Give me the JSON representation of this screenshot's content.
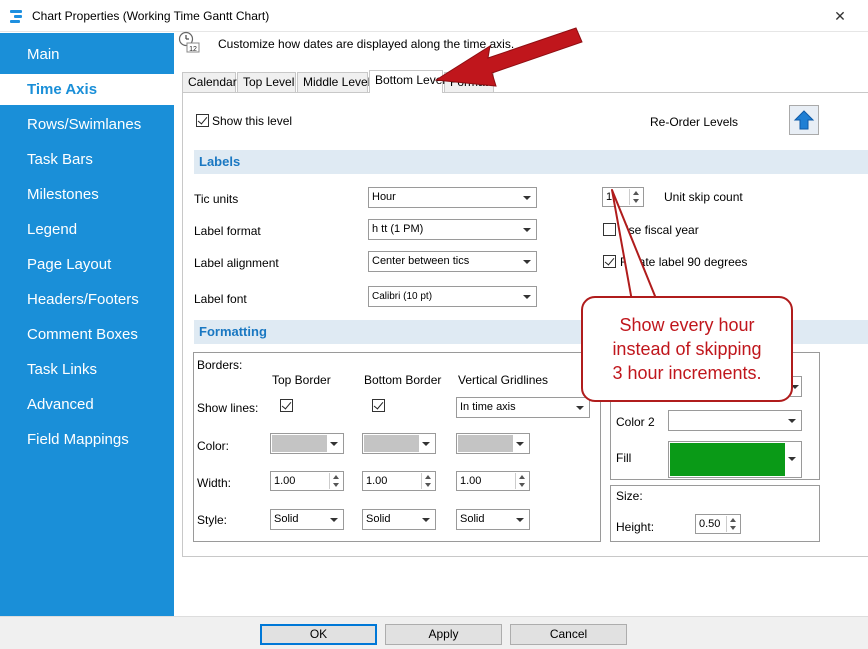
{
  "window": {
    "title": "Chart Properties (Working Time Gantt Chart)",
    "close_glyph": "✕",
    "icon": "app-icon"
  },
  "sidebar": {
    "items": [
      {
        "label": "Main"
      },
      {
        "label": "Time Axis"
      },
      {
        "label": "Rows/Swimlanes"
      },
      {
        "label": "Task Bars"
      },
      {
        "label": "Milestones"
      },
      {
        "label": "Legend"
      },
      {
        "label": "Page Layout"
      },
      {
        "label": "Headers/Footers"
      },
      {
        "label": "Comment Boxes"
      },
      {
        "label": "Task Links"
      },
      {
        "label": "Advanced"
      },
      {
        "label": "Field Mappings"
      }
    ],
    "active": "Time Axis"
  },
  "header": {
    "icon_text": "12",
    "text": "Customize how dates are displayed along the time axis."
  },
  "tabs": [
    {
      "label": "Calendar"
    },
    {
      "label": "Top Level"
    },
    {
      "label": "Middle Level"
    },
    {
      "label": "Bottom Level"
    },
    {
      "label": "Format"
    }
  ],
  "active_tab": "Bottom Level",
  "level": {
    "show_this_level_label": "Show this level",
    "show_this_level_checked": true,
    "reorder_label": "Re-Order Levels"
  },
  "labels_section": {
    "title": "Labels",
    "tic_units_label": "Tic units",
    "tic_units_value": "Hour",
    "label_format_label": "Label format",
    "label_format_value": "h tt (1 PM)",
    "label_alignment_label": "Label alignment",
    "label_alignment_value": "Center between tics",
    "label_font_label": "Label font",
    "label_font_value": "Calibri (10 pt)",
    "unit_skip_value": "1",
    "unit_skip_label": "Unit skip count",
    "fiscal_year_label": "Use fiscal year",
    "fiscal_year_checked": false,
    "rotate_label": "Rotate label 90 degrees",
    "rotate_checked": true
  },
  "formatting_section": {
    "title": "Formatting",
    "borders_label": "Borders:",
    "col_top": "Top Border",
    "col_bottom": "Bottom Border",
    "col_vertical": "Vertical Gridlines",
    "show_lines_label": "Show lines:",
    "top_checked": true,
    "bottom_checked": true,
    "vertical_value": "In time axis",
    "color_label": "Color:",
    "width_label": "Width:",
    "width_top": "1.00",
    "width_bottom": "1.00",
    "width_vertical": "1.00",
    "style_label": "Style:",
    "style_top": "Solid",
    "style_bottom": "Solid",
    "style_vertical": "Solid",
    "color2_label": "Color 2",
    "fill_label": "Fill",
    "fill_color": "#0a9a17",
    "size_label": "Size:",
    "height_label": "Height:",
    "height_value": "0.50"
  },
  "buttons": {
    "ok": "OK",
    "apply": "Apply",
    "cancel": "Cancel"
  },
  "callout": {
    "line1": "Show every hour",
    "line2": "instead of skipping",
    "line3": "3 hour increments."
  },
  "colors": {
    "sidebar": "#1a8fd8",
    "accent_text": "#1a78c2",
    "callout_red": "#c0161c",
    "arrow_red": "#c0161c"
  }
}
